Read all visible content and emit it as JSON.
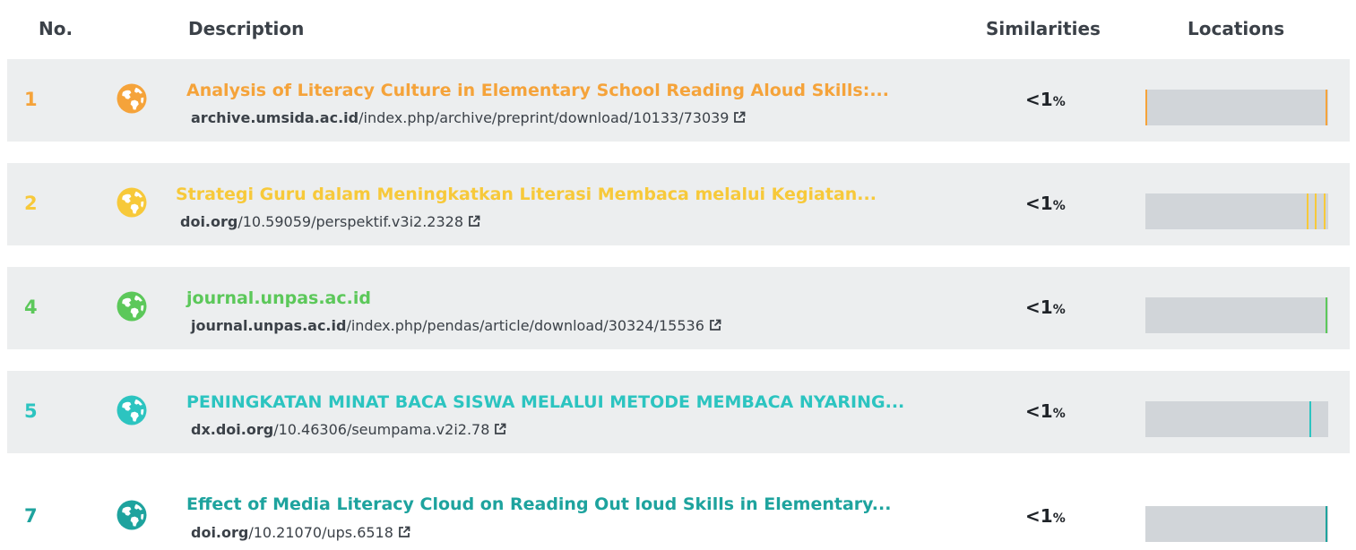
{
  "header": {
    "no": "No.",
    "description": "Description",
    "similarities": "Similarities",
    "locations": "Locations"
  },
  "rows": [
    {
      "number": "1",
      "color": "#f5a33a",
      "icon": "globe-icon",
      "title": "Analysis of Literacy Culture in Elementary School Reading Aloud Skills:...",
      "url_domain": "archive.umsida.ac.id",
      "url_path": "/index.php/archive/preprint/download/10133/73039",
      "similarity": "<1",
      "similarity_unit": "%",
      "location_marks": [
        0.0,
        0.985
      ]
    },
    {
      "number": "2",
      "color": "#f7c93a",
      "icon": "globe-icon",
      "title": "Strategi Guru dalam Meningkatkan Literasi Membaca melalui Kegiatan...",
      "url_domain": "doi.org",
      "url_path": "/10.59059/perspektif.v3i2.2328",
      "similarity": "<1",
      "similarity_unit": "%",
      "location_marks": [
        0.88,
        0.925,
        0.975
      ]
    },
    {
      "number": "4",
      "color": "#5cc85a",
      "icon": "globe-icon",
      "title": "journal.unpas.ac.id",
      "url_domain": "journal.unpas.ac.id",
      "url_path": "/index.php/pendas/article/download/30324/15536",
      "similarity": "<1",
      "similarity_unit": "%",
      "location_marks": [
        0.985
      ]
    },
    {
      "number": "5",
      "color": "#2cc4c0",
      "icon": "globe-icon",
      "title": "PENINGKATAN MINAT BACA SISWA MELALUI METODE MEMBACA NYARING...",
      "url_domain": "dx.doi.org",
      "url_path": "/10.46306/seumpama.v2i2.78",
      "similarity": "<1",
      "similarity_unit": "%",
      "location_marks": [
        0.895
      ]
    },
    {
      "number": "7",
      "color": "#1ea39e",
      "icon": "globe-icon",
      "title": "Effect of Media Literacy Cloud on Reading Out loud Skills in Elementary...",
      "url_domain": "doi.org",
      "url_path": "/10.21070/ups.6518",
      "similarity": "<1",
      "similarity_unit": "%",
      "location_marks": [
        0.985
      ]
    }
  ]
}
